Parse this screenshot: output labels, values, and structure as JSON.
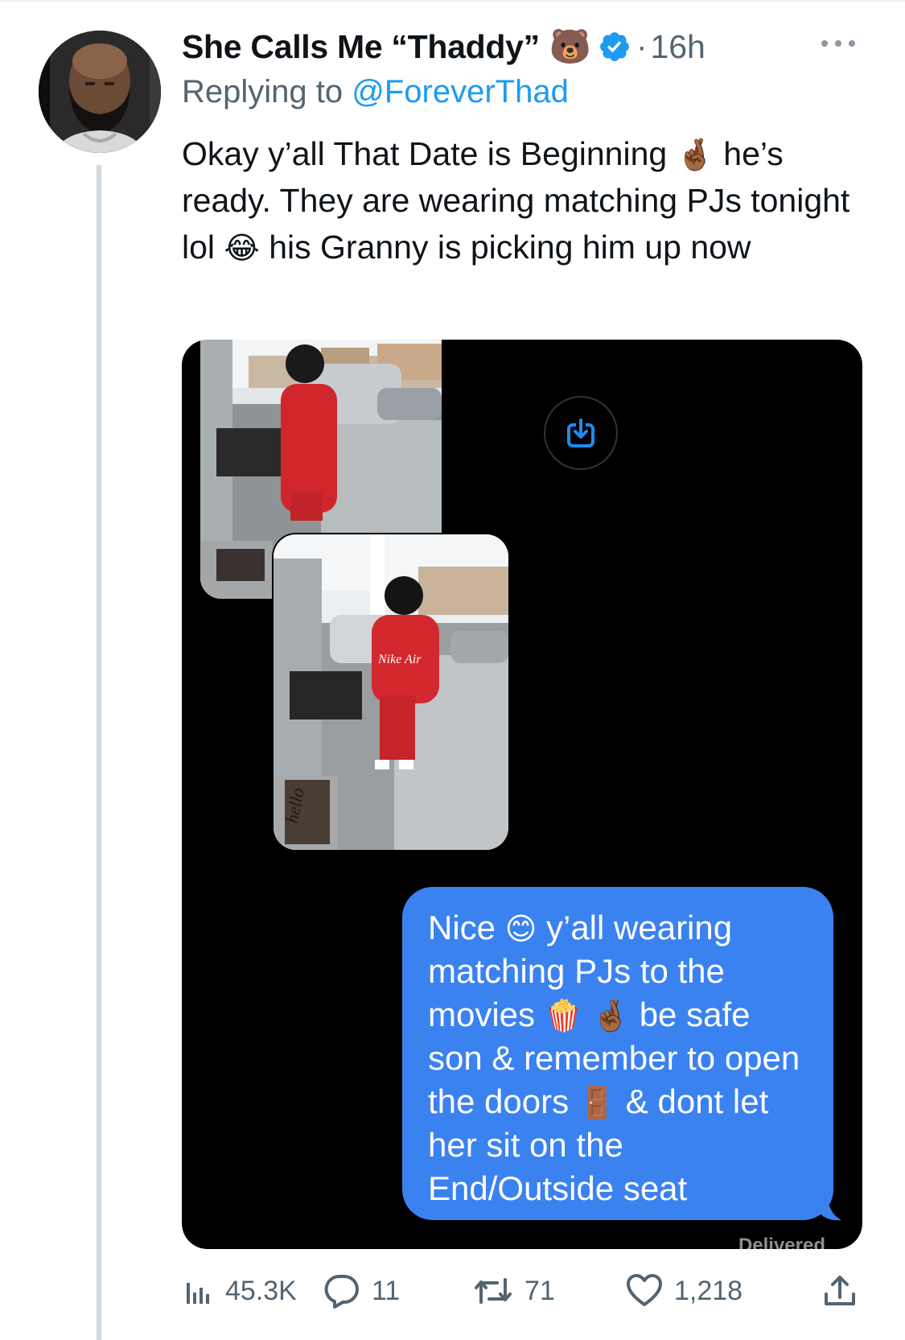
{
  "author": {
    "name": "She Calls Me “Thaddy”",
    "emoji": "🐻",
    "verified": true,
    "time_sep": "·",
    "time": "16h"
  },
  "reply": {
    "prefix": "Replying to ",
    "handle": "@ForeverThad"
  },
  "tweet": {
    "line1a": "Okay y’all That Date is Beginning ",
    "emoji1": "🤞🏾",
    "line1b": " he’s ready. They are wearing matching PJs tonight lol ",
    "emoji2": "😂",
    "line1c": " his Granny is picking him up now"
  },
  "message": {
    "part1": "Nice ",
    "emoji_smile": "😊",
    "part2": " y’all wearing matching PJs to the movies ",
    "emoji_popcorn": "🍿",
    "emoji_fingers": "🤞🏾",
    "part3": " be safe son & remember to open the doors ",
    "emoji_door": "🚪",
    "part4": " & dont let her sit on the End/Outside seat",
    "status": "Delivered",
    "bubble_color": "#3b82f1"
  },
  "photos": {
    "hoodie_text": "Nike Air",
    "doormat_text": "hello"
  },
  "actions": {
    "views": "45.3K",
    "replies": "11",
    "retweets": "71",
    "likes": "1,218"
  },
  "colors": {
    "secondary_text": "#536471",
    "link": "#1d9bf0",
    "thread_line": "#cfd9de"
  }
}
